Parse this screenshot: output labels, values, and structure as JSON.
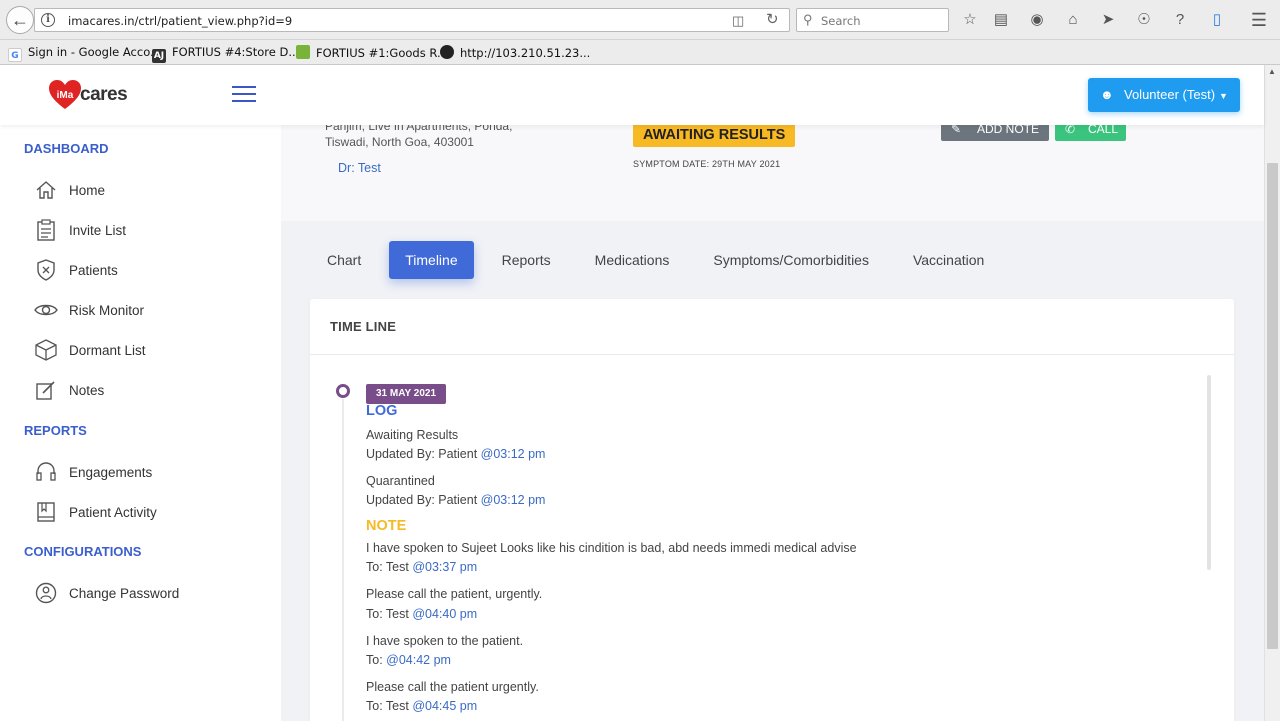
{
  "browser": {
    "url": "imacares.in/ctrl/patient_view.php?id=9",
    "search_placeholder": "Search",
    "bookmarks": [
      {
        "label": "Sign in - Google Acco...",
        "icon": "google-icon"
      },
      {
        "label": "FORTIUS #4:Store D...",
        "icon": "aj-icon"
      },
      {
        "label": "FORTIUS #1:Goods R...",
        "icon": "leaf-icon"
      },
      {
        "label": "http://103.210.51.23...",
        "icon": "globe-icon"
      }
    ]
  },
  "header": {
    "logo_text": "cares",
    "logo_heart_text": "iMa",
    "user_button": "Volunteer (Test)"
  },
  "sidebar": {
    "sections": [
      {
        "title": "DASHBOARD",
        "items": [
          {
            "label": "Home",
            "icon": "home-icon"
          },
          {
            "label": "Invite List",
            "icon": "clipboard-icon"
          },
          {
            "label": "Patients",
            "icon": "shield-icon"
          },
          {
            "label": "Risk Monitor",
            "icon": "eye-icon"
          },
          {
            "label": "Dormant List",
            "icon": "box-icon"
          },
          {
            "label": "Notes",
            "icon": "note-icon"
          }
        ]
      },
      {
        "title": "REPORTS",
        "items": [
          {
            "label": "Engagements",
            "icon": "headset-icon"
          },
          {
            "label": "Patient Activity",
            "icon": "book-icon"
          }
        ]
      },
      {
        "title": "CONFIGURATIONS",
        "items": [
          {
            "label": "Change Password",
            "icon": "user-circle-icon"
          }
        ]
      }
    ]
  },
  "patient": {
    "address_line1": "Panjim, Live In Apartments, Ponda,",
    "address_line2": "Tiswadi, North Goa, 403001",
    "doctor": "Dr: Test",
    "status": "AWAITING RESULTS",
    "symptom_date": "SYMPTOM DATE: 29TH MAY 2021",
    "add_note_label": "ADD NOTE",
    "call_label": "CALL"
  },
  "tabs": [
    {
      "label": "Chart",
      "active": false
    },
    {
      "label": "Timeline",
      "active": true
    },
    {
      "label": "Reports",
      "active": false
    },
    {
      "label": "Medications",
      "active": false
    },
    {
      "label": "Symptoms/Comorbidities",
      "active": false
    },
    {
      "label": "Vaccination",
      "active": false
    }
  ],
  "timeline": {
    "title": "TIME LINE",
    "date_badge": "31 MAY 2021",
    "log_heading": "LOG",
    "log_entries": [
      {
        "text": "Awaiting Results",
        "by": "Updated By: Patient ",
        "time": "@03:12 pm"
      },
      {
        "text": "Quarantined",
        "by": "Updated By: Patient ",
        "time": "@03:12 pm"
      }
    ],
    "note_heading": "NOTE",
    "note_entries": [
      {
        "text": "I have spoken to Sujeet Looks like his cindition is bad, abd needs immedi medical advise",
        "to": "To: Test ",
        "time": "@03:37 pm"
      },
      {
        "text": "Please call the patient, urgently.",
        "to": "To: Test ",
        "time": "@04:40 pm"
      },
      {
        "text": "I have spoken to the patient.",
        "to": "To: ",
        "time": "@04:42 pm"
      },
      {
        "text": "Please call the patient urgently.",
        "to": "To: Test ",
        "time": "@04:45 pm"
      }
    ]
  },
  "colors": {
    "primary": "#3f6ad8",
    "sidebar_heading": "#3a5fcd",
    "status_warning": "#f7b924",
    "date_badge": "#794c8a",
    "note_heading": "#f7b924",
    "call_button": "#3ac47d",
    "volunteer_button": "#1f9bef"
  }
}
